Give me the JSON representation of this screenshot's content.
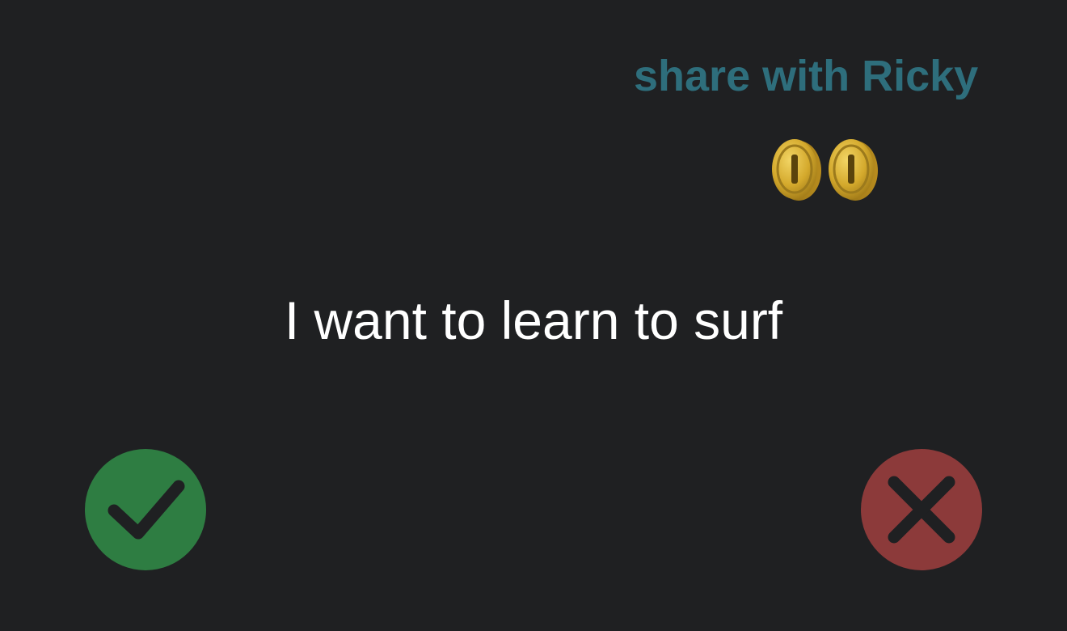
{
  "header": {
    "share_label": "share with Ricky"
  },
  "coins": {
    "count": 2,
    "icon": "gold-coin-icon",
    "color": "#d4a92c"
  },
  "prompt": {
    "text": "I want to learn to surf"
  },
  "actions": {
    "accept": {
      "icon": "checkmark-icon",
      "color": "#2e7d42"
    },
    "reject": {
      "icon": "close-icon",
      "color": "#8c3a3a"
    }
  },
  "colors": {
    "background": "#1f2022",
    "share_text": "#2e6e7c",
    "prompt_text": "#ffffff"
  }
}
